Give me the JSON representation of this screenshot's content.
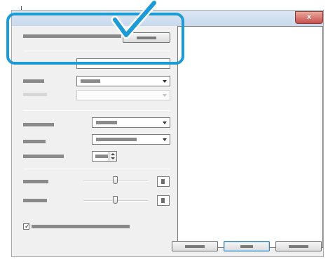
{
  "window": {
    "close_glyph": "x"
  },
  "controls": {
    "checkbox_checked": true,
    "slider1_level": 0.5,
    "slider2_level": 0.5
  },
  "annotation": {
    "callout_color": "#1d9bd6",
    "icon": "checkmark-icon"
  },
  "footer_buttons": [
    {
      "icon": "button-caption",
      "default": false
    },
    {
      "icon": "button-caption",
      "default": true
    },
    {
      "icon": "button-caption",
      "default": false
    }
  ]
}
